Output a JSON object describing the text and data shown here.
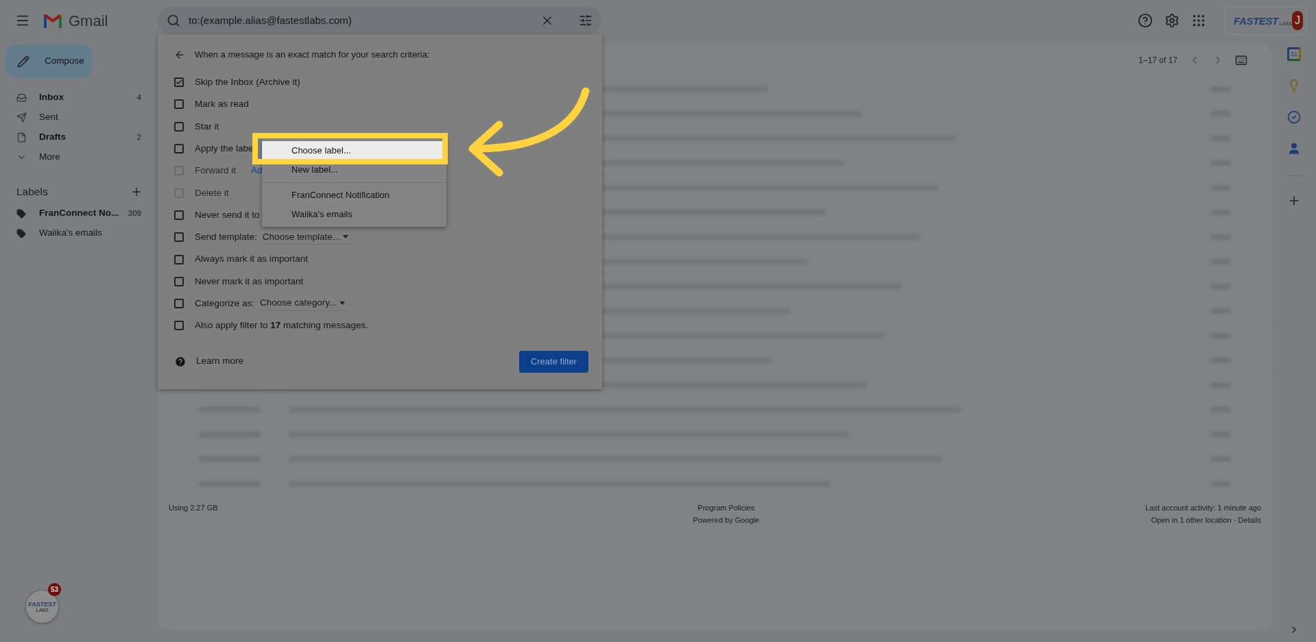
{
  "app": {
    "name": "Gmail"
  },
  "search": {
    "value": "to:(example.alias@fastestlabs.com)"
  },
  "account": {
    "logo_name": "FASTEST",
    "logo_suffix": "LABS",
    "avatar_letter": "J"
  },
  "compose": {
    "label": "Compose"
  },
  "nav": [
    {
      "kind": "inbox",
      "label": "Inbox",
      "count": "4",
      "bold": true
    },
    {
      "kind": "sent",
      "label": "Sent",
      "bold": false
    },
    {
      "kind": "drafts",
      "label": "Drafts",
      "count": "2",
      "bold": true
    },
    {
      "kind": "more",
      "label": "More",
      "bold": false
    }
  ],
  "labels": {
    "title": "Labels",
    "items": [
      {
        "label": "FranConnect No...",
        "count": "309",
        "bold": true
      },
      {
        "label": "Waiika's emails",
        "bold": false
      }
    ]
  },
  "pagination": {
    "range": "1–17 of 17"
  },
  "filter": {
    "heading": "When a message is an exact match for your search criteria:",
    "options": [
      {
        "kind": "plain",
        "label": "Skip the Inbox (Archive it)",
        "checked": true,
        "disabled": false
      },
      {
        "kind": "plain",
        "label": "Mark as read",
        "checked": false,
        "disabled": false
      },
      {
        "kind": "plain",
        "label": "Star it",
        "checked": false,
        "disabled": false
      },
      {
        "kind": "plain",
        "label": "Apply the labe",
        "checked": false,
        "disabled": false
      },
      {
        "kind": "link",
        "label": "Forward it",
        "link": "Ad",
        "checked": false,
        "disabled": true
      },
      {
        "kind": "plain",
        "label": "Delete it",
        "checked": false,
        "disabled": true
      },
      {
        "kind": "plain",
        "label": "Never send it to",
        "checked": false,
        "disabled": false
      },
      {
        "kind": "select",
        "label": "Send template:",
        "value": "Choose template...",
        "checked": false,
        "disabled": false
      },
      {
        "kind": "plain",
        "label": "Always mark it as important",
        "checked": false,
        "disabled": false
      },
      {
        "kind": "plain",
        "label": "Never mark it as important",
        "checked": false,
        "disabled": false
      },
      {
        "kind": "select",
        "label": "Categorize as:",
        "value": "Choose category...",
        "checked": false,
        "disabled": false
      },
      {
        "kind": "rich",
        "label": "Also apply filter to **17** matching messages.",
        "checked": false,
        "disabled": false
      }
    ],
    "learn_more": "Learn more",
    "create_button": "Create filter"
  },
  "label_menu": {
    "groups": [
      [
        {
          "label": "Choose label...",
          "selected": true
        },
        {
          "label": "New label...",
          "selected": false
        }
      ],
      [
        {
          "label": "FranConnect Notification",
          "selected": false
        },
        {
          "label": "Waiika's emails",
          "selected": false
        }
      ]
    ]
  },
  "footer": {
    "storage": "Using 2.27 GB",
    "policies": "Program Policies",
    "powered": "Powered by Google",
    "activity": "Last account activity: 1 minute ago",
    "sessions": "Open in 1 other location · Details"
  },
  "side_panel": {
    "calendar_day": "31"
  },
  "badge": {
    "count": "53",
    "logo_name": "FASTEST",
    "logo_suffix": "LABS"
  }
}
